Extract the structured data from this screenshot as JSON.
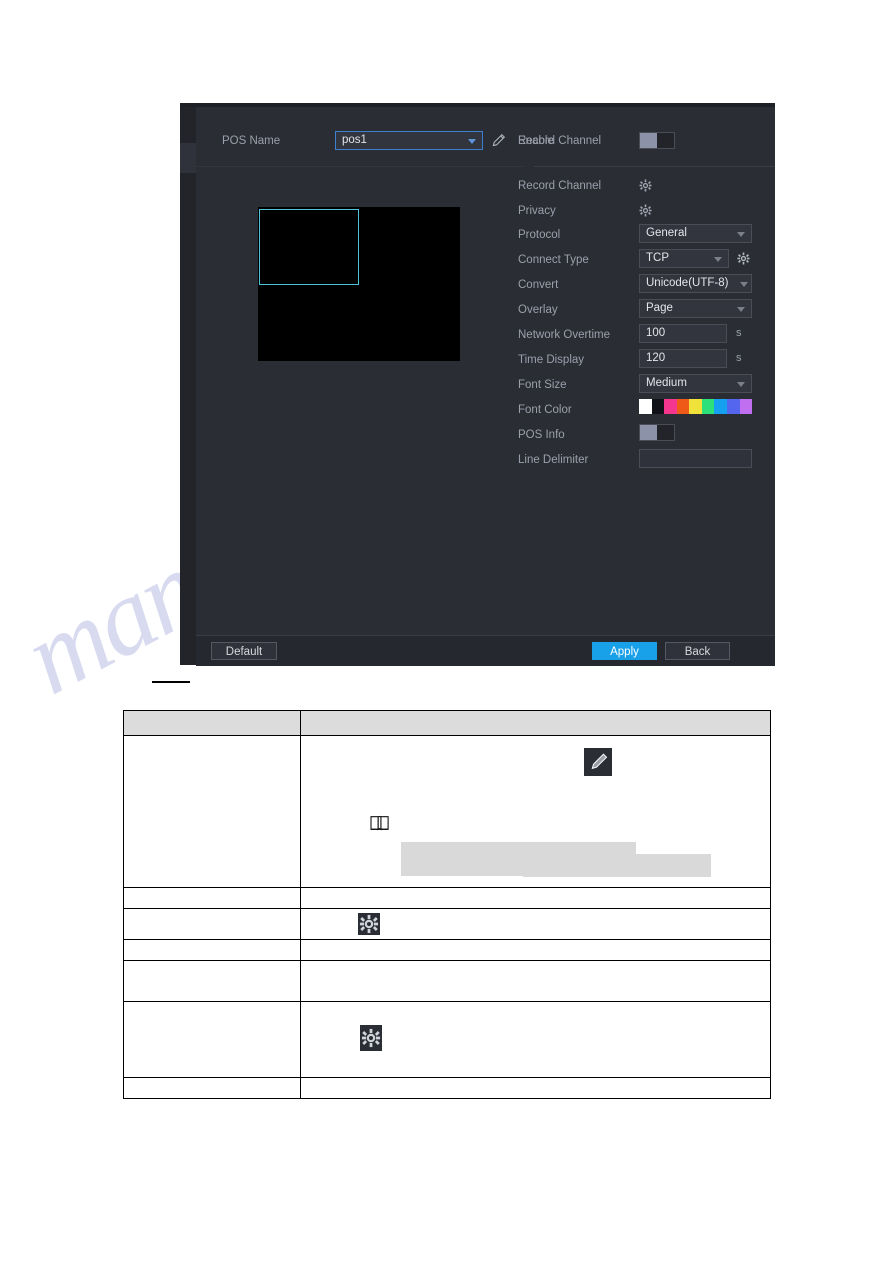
{
  "document": {
    "watermark_text": "manualshive.com",
    "caption_redacted": true
  },
  "dialog": {
    "name": "pos-configuration-dialog",
    "left_label": {
      "pos_name": "POS Name"
    },
    "pos_name": {
      "label": "POS Name",
      "value": "pos1",
      "edit_icon": "pencil-icon",
      "dropdown_icon": "chevron-down-icon"
    },
    "enable": {
      "label": "Enable",
      "state": "off"
    },
    "preview": {
      "name": "video-preview",
      "selection_box_color": "#4fc3d9",
      "background": "#000000"
    },
    "fields": [
      {
        "name": "record-channel",
        "label": "Record Channel",
        "control": "gear",
        "icon": "gear-icon"
      },
      {
        "name": "privacy",
        "label": "Privacy",
        "control": "gear",
        "icon": "gear-icon"
      },
      {
        "name": "protocol",
        "label": "Protocol",
        "control": "select",
        "value": "General"
      },
      {
        "name": "connect-type",
        "label": "Connect Type",
        "control": "select",
        "value": "TCP",
        "extra_icon": "gear-icon"
      },
      {
        "name": "convert",
        "label": "Convert",
        "control": "select",
        "value": "Unicode(UTF-8)"
      },
      {
        "name": "overlay",
        "label": "Overlay",
        "control": "select",
        "value": "Page"
      },
      {
        "name": "network-overtime",
        "label": "Network Overtime",
        "control": "input",
        "value": "100",
        "unit": "s"
      },
      {
        "name": "time-display",
        "label": "Time Display",
        "control": "input",
        "value": "120",
        "unit": "s"
      },
      {
        "name": "font-size",
        "label": "Font Size",
        "control": "select",
        "value": "Medium"
      },
      {
        "name": "font-color",
        "label": "Font Color",
        "control": "swatches"
      },
      {
        "name": "pos-info",
        "label": "POS Info",
        "control": "toggle",
        "state": "off"
      },
      {
        "name": "line-delimiter",
        "label": "Line Delimiter",
        "control": "input",
        "value": ""
      }
    ],
    "font_color": {
      "label": "Font Color",
      "selected_index": 0,
      "swatches": [
        "#ffffff",
        "#111118",
        "#f5368f",
        "#f05a18",
        "#f0e23a",
        "#2ee07a",
        "#15a0f0",
        "#5566ee",
        "#c06ff0"
      ]
    },
    "units": {
      "seconds": "s"
    },
    "footer": {
      "default_label": "Default",
      "apply_label": "Apply",
      "back_label": "Back",
      "apply_color": "#18a0e8"
    }
  },
  "table": {
    "name": "parameter-description-table",
    "header": [
      "",
      ""
    ],
    "rows": [
      {
        "col1": "",
        "col2": "",
        "icons": [
          "pencil-icon",
          "book-note-icon"
        ],
        "redacted": true
      },
      {
        "col1": "",
        "col2": "",
        "icons": [],
        "redacted": false
      },
      {
        "col1": "",
        "col2": "",
        "icons": [
          "gear-icon"
        ],
        "redacted": false
      },
      {
        "col1": "",
        "col2": "",
        "icons": [],
        "redacted": false
      },
      {
        "col1": "",
        "col2": "",
        "icons": [],
        "redacted": false
      },
      {
        "col1": "",
        "col2": "",
        "icons": [
          "gear-icon"
        ],
        "redacted": false
      },
      {
        "col1": "",
        "col2": "",
        "icons": [],
        "redacted": false
      }
    ]
  }
}
